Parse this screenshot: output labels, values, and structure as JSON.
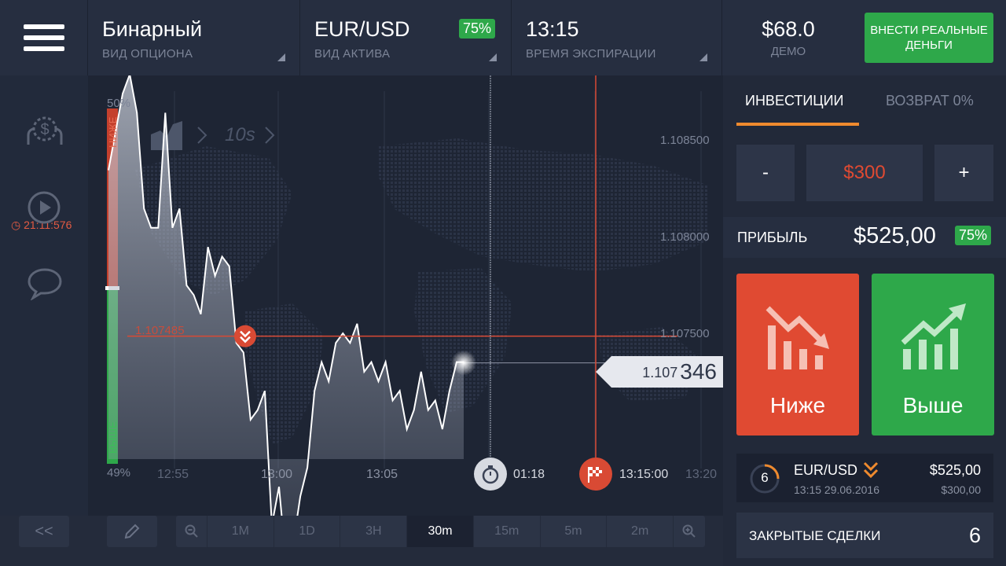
{
  "header": {
    "option_type": {
      "value": "Бинарный",
      "label": "ВИД ОПЦИОНА"
    },
    "asset": {
      "value": "EUR/USD",
      "label": "ВИД АКТИВА",
      "payout": "75%"
    },
    "expiration": {
      "value": "13:15",
      "label": "ВРЕМЯ ЭКСПИРАЦИИ"
    },
    "balance": {
      "amount": "$68.0",
      "label": "ДЕМО"
    },
    "deposit_label": "ВНЕСТИ РЕАЛЬНЫЕ ДЕНЬГИ"
  },
  "sidebar": {
    "timer": "21:11:576",
    "icons": [
      "dollar-coin-icon",
      "play-icon",
      "chat-icon"
    ]
  },
  "chart": {
    "sentiment": {
      "top_percent": "50%",
      "bottom_percent": "49%",
      "down_label": "НИЖЕ",
      "up_label": "ВЫШЕ"
    },
    "interval_label": "10s",
    "price_levels": [
      "1.108500",
      "1.108000",
      "1.107500"
    ],
    "entry_price": "1.107485",
    "current_price_small": "1.107",
    "current_price_big": "346",
    "time_labels": [
      "12:55",
      "13:00",
      "13:05"
    ],
    "countdown": "01:18",
    "expiry_time": "13:15:00",
    "end_time": "13:20"
  },
  "chart_data": {
    "type": "line",
    "title": "",
    "xlabel": "",
    "ylabel": "",
    "x_ticks": [
      "12:55",
      "13:00",
      "13:05",
      "13:20"
    ],
    "y_ticks": [
      1.1085,
      1.108,
      1.1075
    ],
    "entry_level": 1.107485,
    "current_value": 1.107346,
    "series": [
      {
        "values": [
          1.10835,
          1.10855,
          1.10875,
          1.10885,
          1.10865,
          1.10815,
          1.10805,
          1.10805,
          1.10865,
          1.10805,
          1.10815,
          1.10775,
          1.1077,
          1.1076,
          1.10795,
          1.1078,
          1.1079,
          1.10785,
          1.10745,
          1.1074,
          1.10705,
          1.1071,
          1.1072,
          1.1065,
          1.1067,
          1.1063,
          1.1064,
          1.10665,
          1.1068,
          1.1072,
          1.10735,
          1.10725,
          1.10745,
          1.1075,
          1.10745,
          1.10755,
          1.1073,
          1.10735,
          1.10725,
          1.10735,
          1.10715,
          1.1072,
          1.107,
          1.1071,
          1.1073,
          1.1071,
          1.10715,
          1.107,
          1.1072,
          1.10735,
          1.10735
        ]
      }
    ]
  },
  "toolbar": {
    "collapse_label": "<<",
    "timeframes": [
      "1M",
      "1D",
      "3H",
      "30m",
      "15m",
      "5m",
      "2m"
    ],
    "active_timeframe": "30m"
  },
  "panel": {
    "tab_invest": "ИНВЕСТИЦИИ",
    "tab_return": "ВОЗВРАТ 0%",
    "minus": "-",
    "amount": "$300",
    "plus": "+",
    "profit_label": "ПРИБЫЛЬ",
    "profit_value": "$525,00",
    "profit_percent": "75%",
    "down_label": "Ниже",
    "up_label": "Выше",
    "deal": {
      "count": "6",
      "asset": "EUR/USD",
      "datetime": "13:15 29.06.2016",
      "payout": "$525,00",
      "investment": "$300,00"
    },
    "closed_label": "ЗАКРЫТЫЕ СДЕЛКИ",
    "closed_count": "6"
  },
  "colors": {
    "up": "#2ea84a",
    "down": "#e04a32",
    "accent": "#ef8a2e"
  }
}
